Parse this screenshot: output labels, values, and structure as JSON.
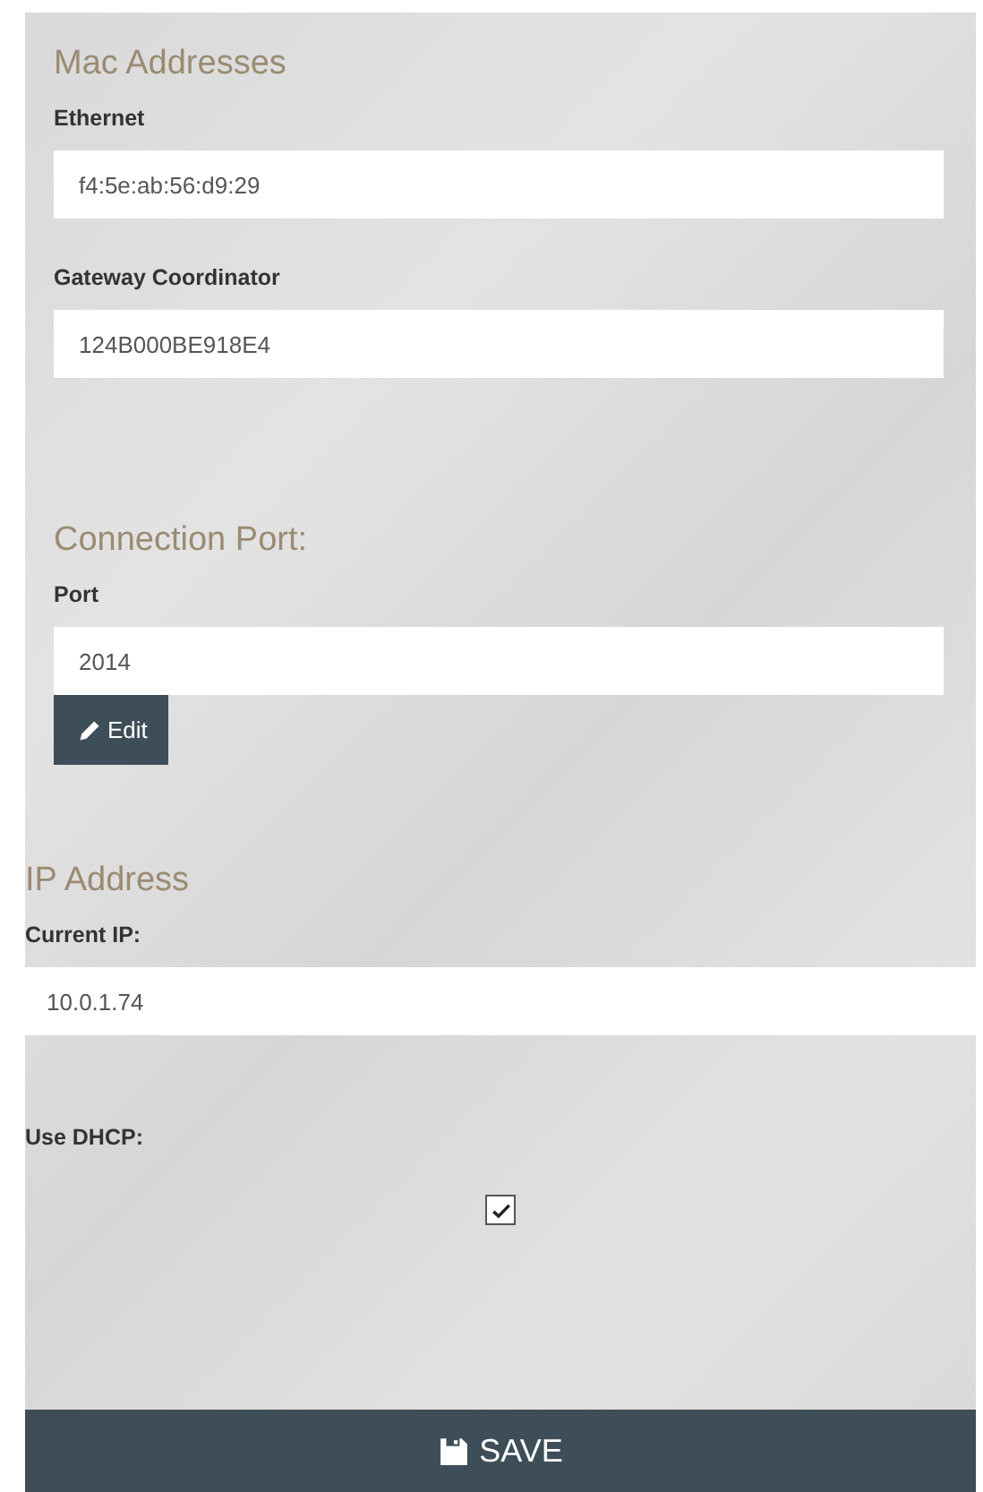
{
  "sections": [
    {
      "title": "Mac Addresses",
      "fields": [
        {
          "kind": "text",
          "label": "Ethernet",
          "value": "f4:5e:ab:56:d9:29"
        },
        {
          "kind": "text",
          "label": "Gateway Coordinator",
          "value": "124B000BE918E4"
        }
      ]
    },
    {
      "title": "Connection Port:",
      "fields": [
        {
          "kind": "text",
          "label": "Port",
          "value": "2014"
        }
      ],
      "button": "Edit"
    },
    {
      "title": "IP Address",
      "fields": [
        {
          "kind": "text",
          "label": "Current IP:",
          "value": "10.0.1.74"
        },
        {
          "kind": "checkbox",
          "label": "Use DHCP:",
          "checked": true
        }
      ]
    }
  ],
  "save_button": "SAVE"
}
